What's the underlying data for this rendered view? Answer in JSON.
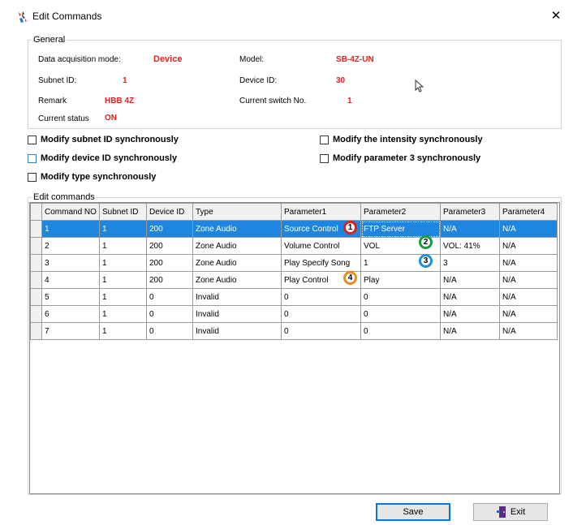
{
  "window": {
    "title": "Edit Commands",
    "close_glyph": "✕"
  },
  "general": {
    "legend": "General",
    "data_acq_label": "Data acquisition mode:",
    "data_acq_value": "Device",
    "model_label": "Model:",
    "model_value": "SB-4Z-UN",
    "subnet_label": "Subnet ID:",
    "subnet_value": "1",
    "device_label": "Device ID:",
    "device_value": "30",
    "remark_label": "Remark",
    "remark_value": "HBB 4Z",
    "switch_label": "Current switch No.",
    "switch_value": "1",
    "status_label": "Current status",
    "status_value": "ON"
  },
  "options": {
    "subnet_sync": "Modify subnet ID synchronously",
    "device_sync": "Modify device ID synchronously",
    "type_sync": "Modify type synchronously",
    "intensity_sync": "Modify the intensity synchronously",
    "param3_sync": "Modify parameter 3 synchronously"
  },
  "edit": {
    "legend": "Edit commands",
    "columns": [
      "Command NO",
      "Subnet ID",
      "Device ID",
      "Type",
      "Parameter1",
      "Parameter2",
      "Parameter3",
      "Parameter4"
    ],
    "rows": [
      [
        "1",
        "1",
        "200",
        "Zone Audio",
        "Source Control",
        "FTP Server",
        "N/A",
        "N/A"
      ],
      [
        "2",
        "1",
        "200",
        "Zone Audio",
        "Volume Control",
        "VOL",
        "VOL: 41%",
        "N/A"
      ],
      [
        "3",
        "1",
        "200",
        "Zone Audio",
        "Play Specify Song",
        "1",
        "3",
        "N/A"
      ],
      [
        "4",
        "1",
        "200",
        "Zone Audio",
        "Play Control",
        "Play",
        "N/A",
        "N/A"
      ],
      [
        "5",
        "1",
        "0",
        "Invalid",
        "0",
        "0",
        "N/A",
        "N/A"
      ],
      [
        "6",
        "1",
        "0",
        "Invalid",
        "0",
        "0",
        "N/A",
        "N/A"
      ],
      [
        "7",
        "1",
        "0",
        "Invalid",
        "0",
        "0",
        "N/A",
        "N/A"
      ]
    ]
  },
  "annotations": [
    {
      "label": "1",
      "color": "#e02020"
    },
    {
      "label": "2",
      "color": "#1a9a3c"
    },
    {
      "label": "3",
      "color": "#1e90d6"
    },
    {
      "label": "4",
      "color": "#f08a1c"
    }
  ],
  "buttons": {
    "save": "Save",
    "exit": "Exit"
  },
  "colors": {
    "accent_red": "#e41e1e",
    "selection": "#1e86de"
  }
}
